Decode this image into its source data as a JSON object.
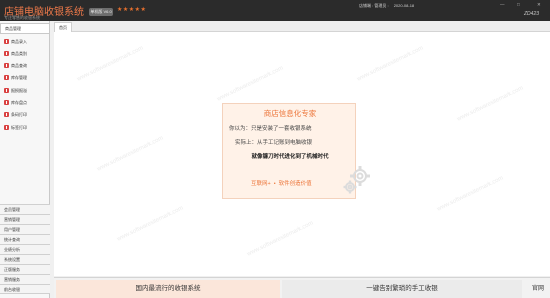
{
  "titlebar": {
    "app_title": "店铺电脑收银系统",
    "app_subtitle": "专注零售的收银系统",
    "edition_badge": "单机版 V6.0",
    "stars": "★★★★★",
    "operator_label": "店铺端 : 管理员 :",
    "date": "2020-08-18",
    "version": "ZD423",
    "window_buttons": {
      "minimize": "—",
      "maximize": "□",
      "close": "✕"
    }
  },
  "sidebar": {
    "header": "商品管理",
    "items": [
      {
        "label": "商品录入",
        "icon": "product-entry-icon"
      },
      {
        "label": "商品类别",
        "icon": "category-icon"
      },
      {
        "label": "商品查询",
        "icon": "product-search-icon"
      },
      {
        "label": "库存管理",
        "icon": "inventory-icon"
      },
      {
        "label": "报损报溢",
        "icon": "loss-report-icon"
      },
      {
        "label": "库存盘点",
        "icon": "stocktake-icon"
      },
      {
        "label": "条码打印",
        "icon": "barcode-print-icon"
      },
      {
        "label": "标签打印",
        "icon": "label-print-icon"
      }
    ],
    "categories": [
      {
        "label": "会员管理"
      },
      {
        "label": "营销管理"
      },
      {
        "label": "用户管理"
      },
      {
        "label": "统计查询"
      },
      {
        "label": "业绩分析"
      },
      {
        "label": "系统设置"
      },
      {
        "label": "正版服务"
      },
      {
        "label": "营销服务"
      },
      {
        "label": "前台收银"
      }
    ]
  },
  "tabs": [
    {
      "label": "首页"
    }
  ],
  "promo": {
    "title": "商店信息化专家",
    "line1": "你以为：只是安装了一套收银系统",
    "line2": "实际上：从手工记账到电脑收银",
    "slogan": "就像镰刀时代进化到了机械时代",
    "link1": "互联网+",
    "link2": "软件创造价值"
  },
  "bottom_bar": {
    "left_text": "国内最流行的收银系统",
    "right_text": "一键告别繁琐的手工收银",
    "site_link": "官网"
  },
  "watermark_text": "www.softwaresitemark.com",
  "colors": {
    "accent": "#ec7438",
    "titlebar_bg": "#2b2b2b",
    "sidebar_icon": "#d94040",
    "promo_bg": "#fff2e8"
  }
}
